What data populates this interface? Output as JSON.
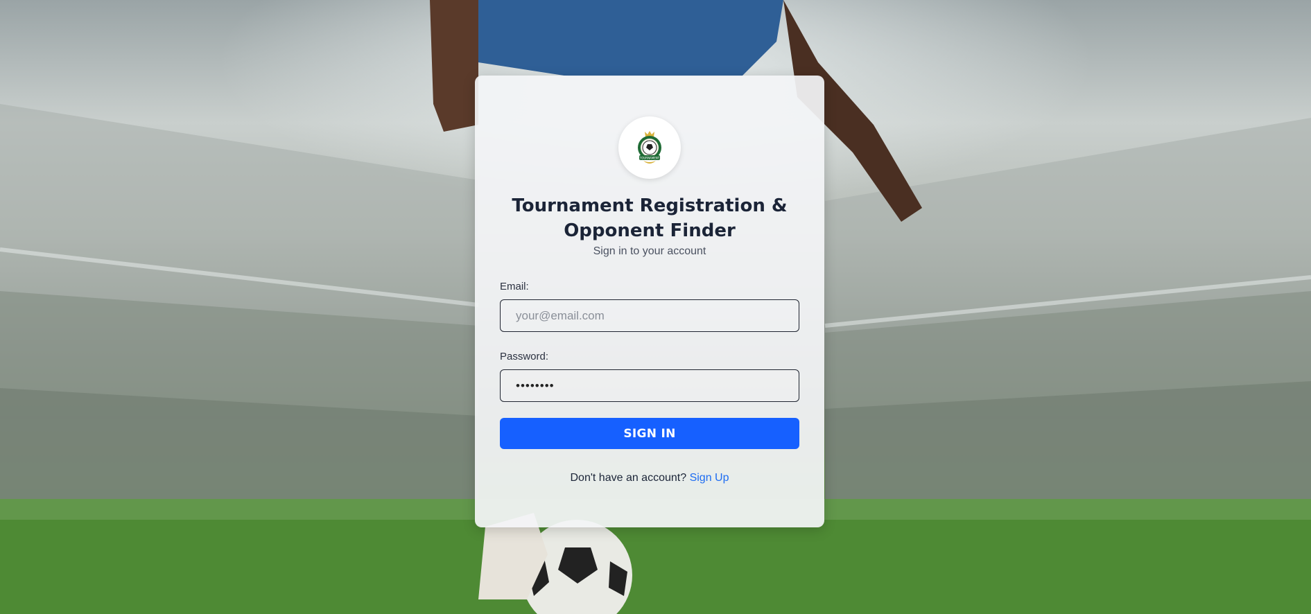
{
  "header": {
    "title": "Tournament Registration & Opponent Finder",
    "subtitle": "Sign in to your account"
  },
  "logo": {
    "icon": "soccer-ball-crest-icon",
    "text": "TOURNAMENT"
  },
  "form": {
    "email_label": "Email:",
    "email_placeholder": "your@email.com",
    "email_value": "",
    "password_label": "Password:",
    "password_value": "••••••••",
    "submit_label": "SIGN IN"
  },
  "footer": {
    "prompt": "Don't have an account?",
    "link": "Sign Up"
  },
  "colors": {
    "accent": "#1660ff",
    "link": "#1d6cf2",
    "title": "#1b2437"
  }
}
